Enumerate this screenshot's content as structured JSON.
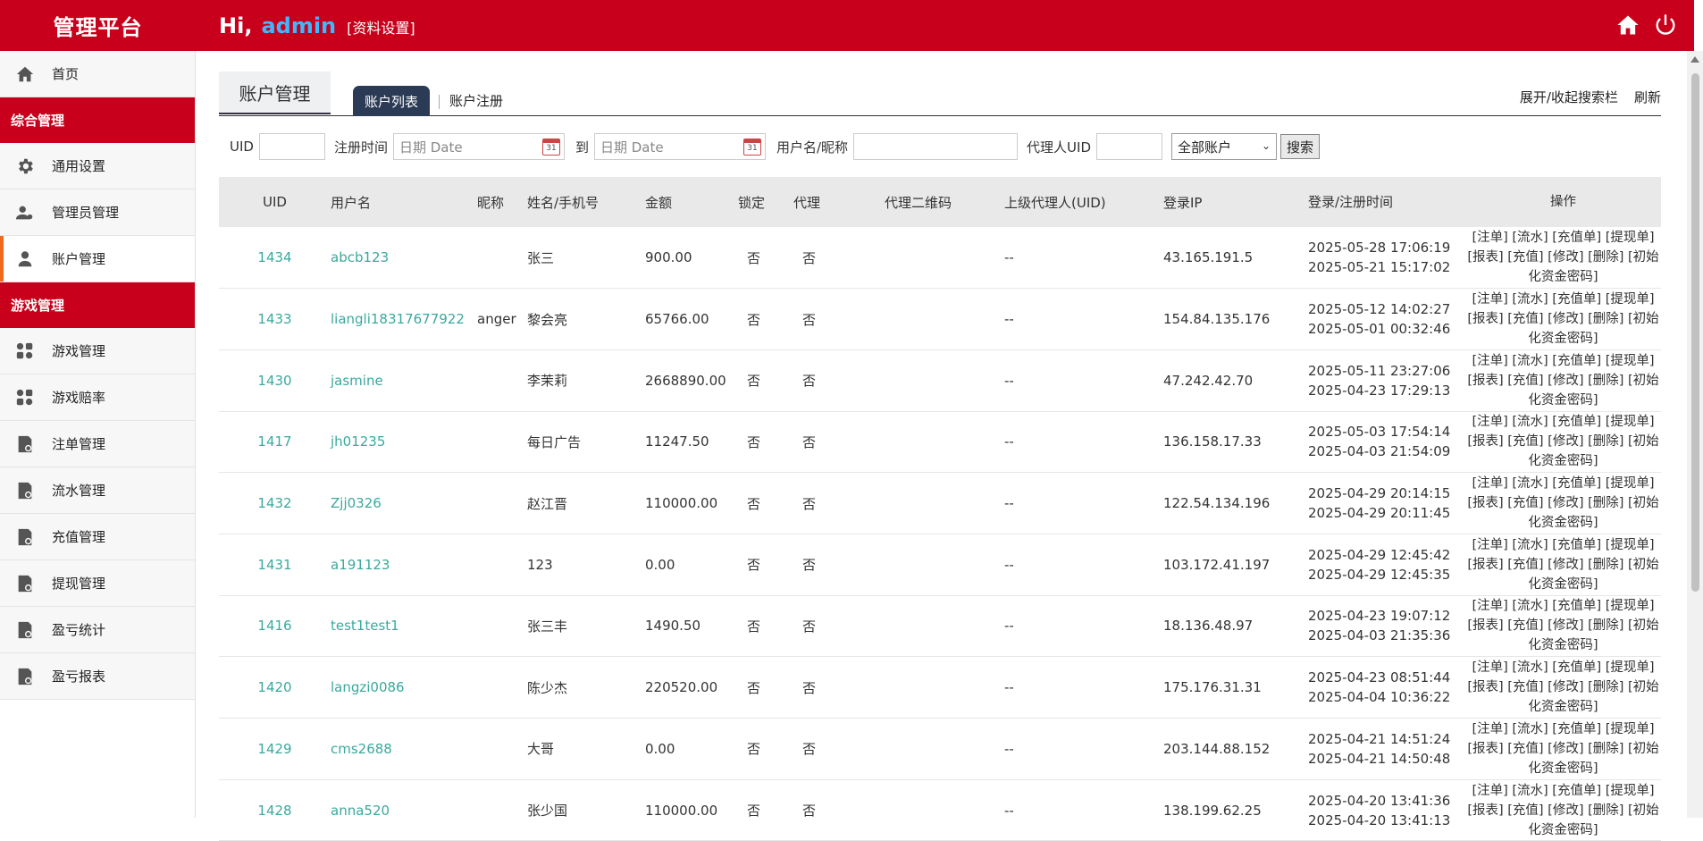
{
  "header": {
    "brand": "管理平台",
    "greeting": "Hi,",
    "username": "admin",
    "profile_link": "[资料设置]",
    "home_icon": "home-icon",
    "power_icon": "power-icon"
  },
  "sidebar": {
    "items": [
      {
        "type": "item",
        "label": "首页",
        "icon": "home-icon",
        "active": false
      },
      {
        "type": "group",
        "label": "综合管理"
      },
      {
        "type": "item",
        "label": "通用设置",
        "icon": "gear-icon",
        "active": false
      },
      {
        "type": "item",
        "label": "管理员管理",
        "icon": "user-admin-icon",
        "active": false
      },
      {
        "type": "item",
        "label": "账户管理",
        "icon": "user-icon",
        "active": true
      },
      {
        "type": "group",
        "label": "游戏管理"
      },
      {
        "type": "item",
        "label": "游戏管理",
        "icon": "apps-icon",
        "active": false
      },
      {
        "type": "item",
        "label": "游戏赔率",
        "icon": "apps-icon",
        "active": false
      },
      {
        "type": "item",
        "label": "注单管理",
        "icon": "report-icon",
        "active": false
      },
      {
        "type": "item",
        "label": "流水管理",
        "icon": "report-icon",
        "active": false
      },
      {
        "type": "item",
        "label": "充值管理",
        "icon": "report-icon",
        "active": false
      },
      {
        "type": "item",
        "label": "提现管理",
        "icon": "report-icon",
        "active": false
      },
      {
        "type": "item",
        "label": "盈亏统计",
        "icon": "report-icon",
        "active": false
      },
      {
        "type": "item",
        "label": "盈亏报表",
        "icon": "report-icon",
        "active": false
      }
    ]
  },
  "tabs": {
    "title": "账户管理",
    "active_tab": "账户列表",
    "other_tab": "账户注册",
    "toggle_search": "展开/收起搜索栏",
    "refresh": "刷新"
  },
  "search": {
    "uid_label": "UID",
    "uid_value": "",
    "reg_time_label": "注册时间",
    "date_placeholder": "日期 Date",
    "to_label": "到",
    "username_label": "用户名/昵称",
    "username_value": "",
    "agent_uid_label": "代理人UID",
    "agent_uid_value": "",
    "account_select": "全部账户",
    "search_button": "搜索",
    "calendar_day": "31"
  },
  "table": {
    "headers": [
      "UID",
      "用户名",
      "昵称",
      "姓名/手机号",
      "金额",
      "锁定",
      "代理",
      "代理二维码",
      "上级代理人(UID)",
      "登录IP",
      "登录/注册时间",
      "操作"
    ],
    "ops_line1": "[注单] [流水] [充值单] [提现单]",
    "ops_line2": "[报表] [充值] [修改] [删除] [初始",
    "ops_line3": "化资金密码]",
    "rows": [
      {
        "uid": "1434",
        "username": "abcb123",
        "nickname": "",
        "name": "张三",
        "amount": "900.00",
        "locked": "否",
        "agent": "否",
        "qr": "",
        "parent": "--",
        "ip": "43.165.191.5",
        "login": "2025-05-28 17:06:19",
        "register": "2025-05-21 15:17:02"
      },
      {
        "uid": "1433",
        "username": "liangli18317677922",
        "nickname": "anger",
        "name": "黎会亮",
        "amount": "65766.00",
        "locked": "否",
        "agent": "否",
        "qr": "",
        "parent": "--",
        "ip": "154.84.135.176",
        "login": "2025-05-12 14:02:27",
        "register": "2025-05-01 00:32:46"
      },
      {
        "uid": "1430",
        "username": "jasmine",
        "nickname": "",
        "name": "李茉莉",
        "amount": "2668890.00",
        "locked": "否",
        "agent": "否",
        "qr": "",
        "parent": "--",
        "ip": "47.242.42.70",
        "login": "2025-05-11 23:27:06",
        "register": "2025-04-23 17:29:13"
      },
      {
        "uid": "1417",
        "username": "jh01235",
        "nickname": "",
        "name": "每日广告",
        "amount": "11247.50",
        "locked": "否",
        "agent": "否",
        "qr": "",
        "parent": "--",
        "ip": "136.158.17.33",
        "login": "2025-05-03 17:54:14",
        "register": "2025-04-03 21:54:09"
      },
      {
        "uid": "1432",
        "username": "Zjj0326",
        "nickname": "",
        "name": "赵江晋",
        "amount": "110000.00",
        "locked": "否",
        "agent": "否",
        "qr": "",
        "parent": "--",
        "ip": "122.54.134.196",
        "login": "2025-04-29 20:14:15",
        "register": "2025-04-29 20:11:45"
      },
      {
        "uid": "1431",
        "username": "a191123",
        "nickname": "",
        "name": "123",
        "amount": "0.00",
        "locked": "否",
        "agent": "否",
        "qr": "",
        "parent": "--",
        "ip": "103.172.41.197",
        "login": "2025-04-29 12:45:42",
        "register": "2025-04-29 12:45:35"
      },
      {
        "uid": "1416",
        "username": "test1test1",
        "nickname": "",
        "name": "张三丰",
        "amount": "1490.50",
        "locked": "否",
        "agent": "否",
        "qr": "",
        "parent": "--",
        "ip": "18.136.48.97",
        "login": "2025-04-23 19:07:12",
        "register": "2025-04-03 21:35:36"
      },
      {
        "uid": "1420",
        "username": "langzi0086",
        "nickname": "",
        "name": "陈少杰",
        "amount": "220520.00",
        "locked": "否",
        "agent": "否",
        "qr": "",
        "parent": "--",
        "ip": "175.176.31.31",
        "login": "2025-04-23 08:51:44",
        "register": "2025-04-04 10:36:22"
      },
      {
        "uid": "1429",
        "username": "cms2688",
        "nickname": "",
        "name": "大哥",
        "amount": "0.00",
        "locked": "否",
        "agent": "否",
        "qr": "",
        "parent": "--",
        "ip": "203.144.88.152",
        "login": "2025-04-21 14:51:24",
        "register": "2025-04-21 14:50:48"
      },
      {
        "uid": "1428",
        "username": "anna520",
        "nickname": "",
        "name": "张少国",
        "amount": "110000.00",
        "locked": "否",
        "agent": "否",
        "qr": "",
        "parent": "--",
        "ip": "138.199.62.25",
        "login": "2025-04-20 13:41:36",
        "register": "2025-04-20 13:41:13"
      }
    ]
  }
}
